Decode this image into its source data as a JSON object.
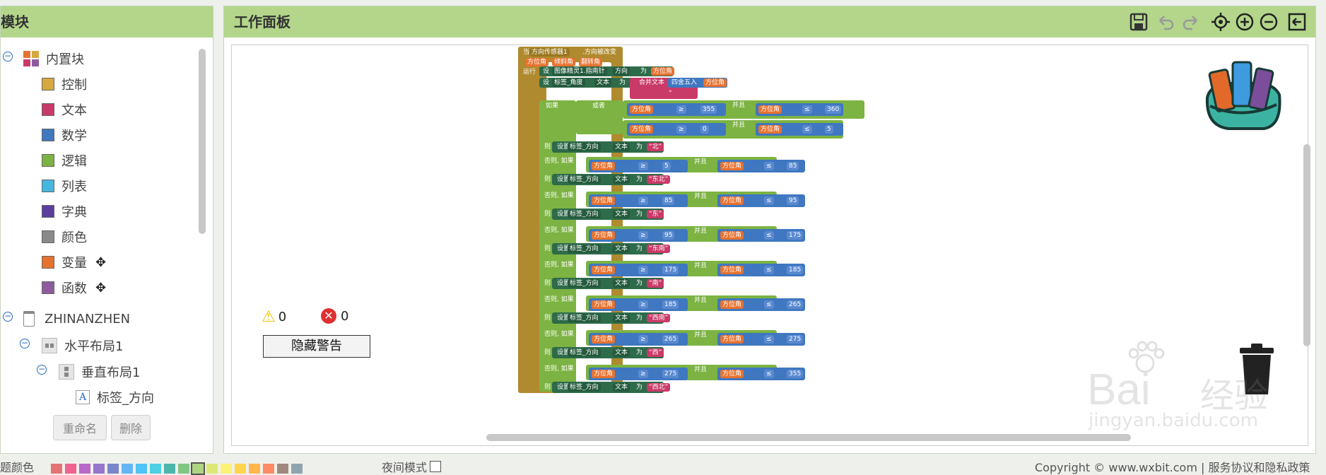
{
  "left_panel": {
    "title": "模块",
    "builtin": {
      "label": "内置块",
      "toggle": "−"
    },
    "categories": [
      {
        "label": "控制",
        "color": "#d6a83f"
      },
      {
        "label": "文本",
        "color": "#c93a68"
      },
      {
        "label": "数学",
        "color": "#3f77c0"
      },
      {
        "label": "逻辑",
        "color": "#7cb342"
      },
      {
        "label": "列表",
        "color": "#45b6e0"
      },
      {
        "label": "字典",
        "color": "#5a3f9e"
      },
      {
        "label": "颜色",
        "color": "#8a8a8a"
      },
      {
        "label": "变量",
        "color": "#e67230"
      },
      {
        "label": "函数",
        "color": "#8e5aa0"
      }
    ],
    "components": [
      {
        "label": "ZHINANZHEN",
        "toggle": "−"
      },
      {
        "label": "水平布局1",
        "toggle": "−"
      },
      {
        "label": "垂直布局1",
        "toggle": "−"
      },
      {
        "label": "标签_方向"
      }
    ],
    "rename_button": "重命名",
    "delete_button": "删除"
  },
  "workspace": {
    "title": "工作面板",
    "warnings_count": "0",
    "errors_count": "0",
    "hide_warnings_button": "隐藏警告",
    "event_block": {
      "header": [
        "当",
        "方向传感器1",
        ".方向被改变"
      ],
      "params": [
        "方位角",
        "倾斜角",
        "翻转角"
      ],
      "run_label": "运行",
      "set_heading": [
        "设",
        "图像精灵1.指南针",
        ".",
        "方向",
        "为",
        "方位角"
      ],
      "set_angle_text": [
        "设",
        "标签_角度",
        ".",
        "文本",
        "为",
        "合并文本",
        "四舍五入",
        "方位角",
        "°"
      ],
      "if_label": "如果",
      "or_label": "或者",
      "then_label": "则",
      "elseif_label": "否则, 如果",
      "and_label": "并且",
      "var": "方位角",
      "ge": "≥",
      "le": "≤",
      "set_dir_parts": [
        "设置",
        "标签_方向",
        ".",
        "文本",
        "为"
      ],
      "first_cond": {
        "a": "355",
        "b": "360",
        "c": "0",
        "d": "5"
      },
      "conditions": [
        {
          "lo": "5",
          "hi": "85"
        },
        {
          "lo": "85",
          "hi": "95"
        },
        {
          "lo": "95",
          "hi": "175"
        },
        {
          "lo": "175",
          "hi": "185"
        },
        {
          "lo": "185",
          "hi": "265"
        },
        {
          "lo": "265",
          "hi": "275"
        },
        {
          "lo": "275",
          "hi": "355"
        }
      ],
      "directions": [
        "北",
        "东北",
        "东",
        "东南",
        "南",
        "西南",
        "西",
        "西北"
      ]
    },
    "watermark": {
      "brand": "Bai",
      "brand2": "经验",
      "url": "jingyan.baidu.com"
    }
  },
  "toolbar_icons": [
    "save-icon",
    "undo-icon",
    "redo-icon",
    "target-icon",
    "zoom-in-icon",
    "zoom-out-icon",
    "exit-icon"
  ],
  "footer": {
    "left_label": "题颜色",
    "night_mode": "夜间模式",
    "copyright": "Copyright © www.wxbit.com | 服务协议和隐私政策",
    "swatches": [
      "#e57373",
      "#f06292",
      "#ba68c8",
      "#9575cd",
      "#7986cb",
      "#64b5f6",
      "#4fc3f7",
      "#4dd0e1",
      "#4db6ac",
      "#81c784",
      "#aed581",
      "#dce775",
      "#fff176",
      "#ffd54f",
      "#ffb74d",
      "#ff8a65",
      "#a1887f",
      "#90a4ae"
    ]
  },
  "colors": {
    "header_green": "#b3d68a",
    "event_gold": "#b08a2e",
    "set_green": "#2e6b4a",
    "logic_green": "#7cb342",
    "math_blue": "#3f77c0",
    "var_orange": "#e67230",
    "text_pink": "#c93a68"
  }
}
